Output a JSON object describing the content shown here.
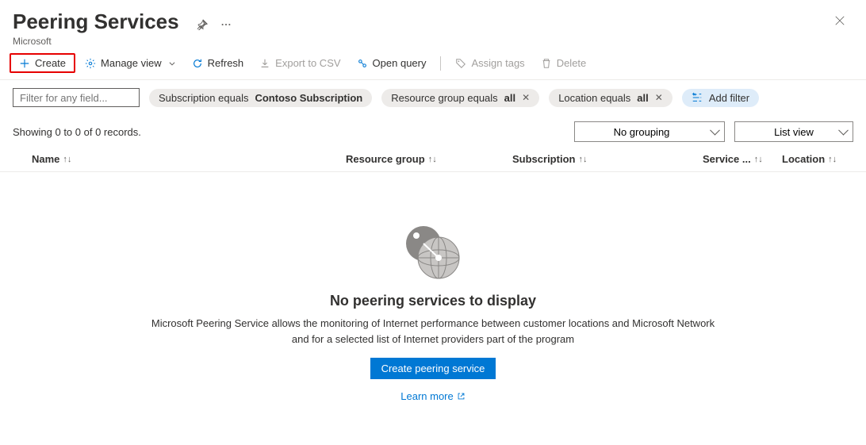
{
  "header": {
    "title": "Peering Services",
    "subtitle": "Microsoft"
  },
  "toolbar": {
    "create": "Create",
    "manage_view": "Manage view",
    "refresh": "Refresh",
    "export_csv": "Export to CSV",
    "open_query": "Open query",
    "assign_tags": "Assign tags",
    "delete": "Delete"
  },
  "filters": {
    "placeholder": "Filter for any field...",
    "subscription": {
      "prefix": "Subscription equals ",
      "value": "Contoso Subscription"
    },
    "resource_group": {
      "prefix": "Resource group equals ",
      "value": "all"
    },
    "location": {
      "prefix": "Location equals ",
      "value": "all"
    },
    "add_filter": "Add filter"
  },
  "status": {
    "records_text": "Showing 0 to 0 of 0 records.",
    "grouping": "No grouping",
    "view_mode": "List view"
  },
  "columns": {
    "name": "Name",
    "resource_group": "Resource group",
    "subscription": "Subscription",
    "service": "Service ...",
    "location": "Location"
  },
  "empty": {
    "title": "No peering services to display",
    "description": "Microsoft Peering Service allows the monitoring of Internet performance between customer locations and Microsoft Network and for a selected list of Internet providers part of the program",
    "primary_button": "Create peering service",
    "learn_more": "Learn more"
  }
}
